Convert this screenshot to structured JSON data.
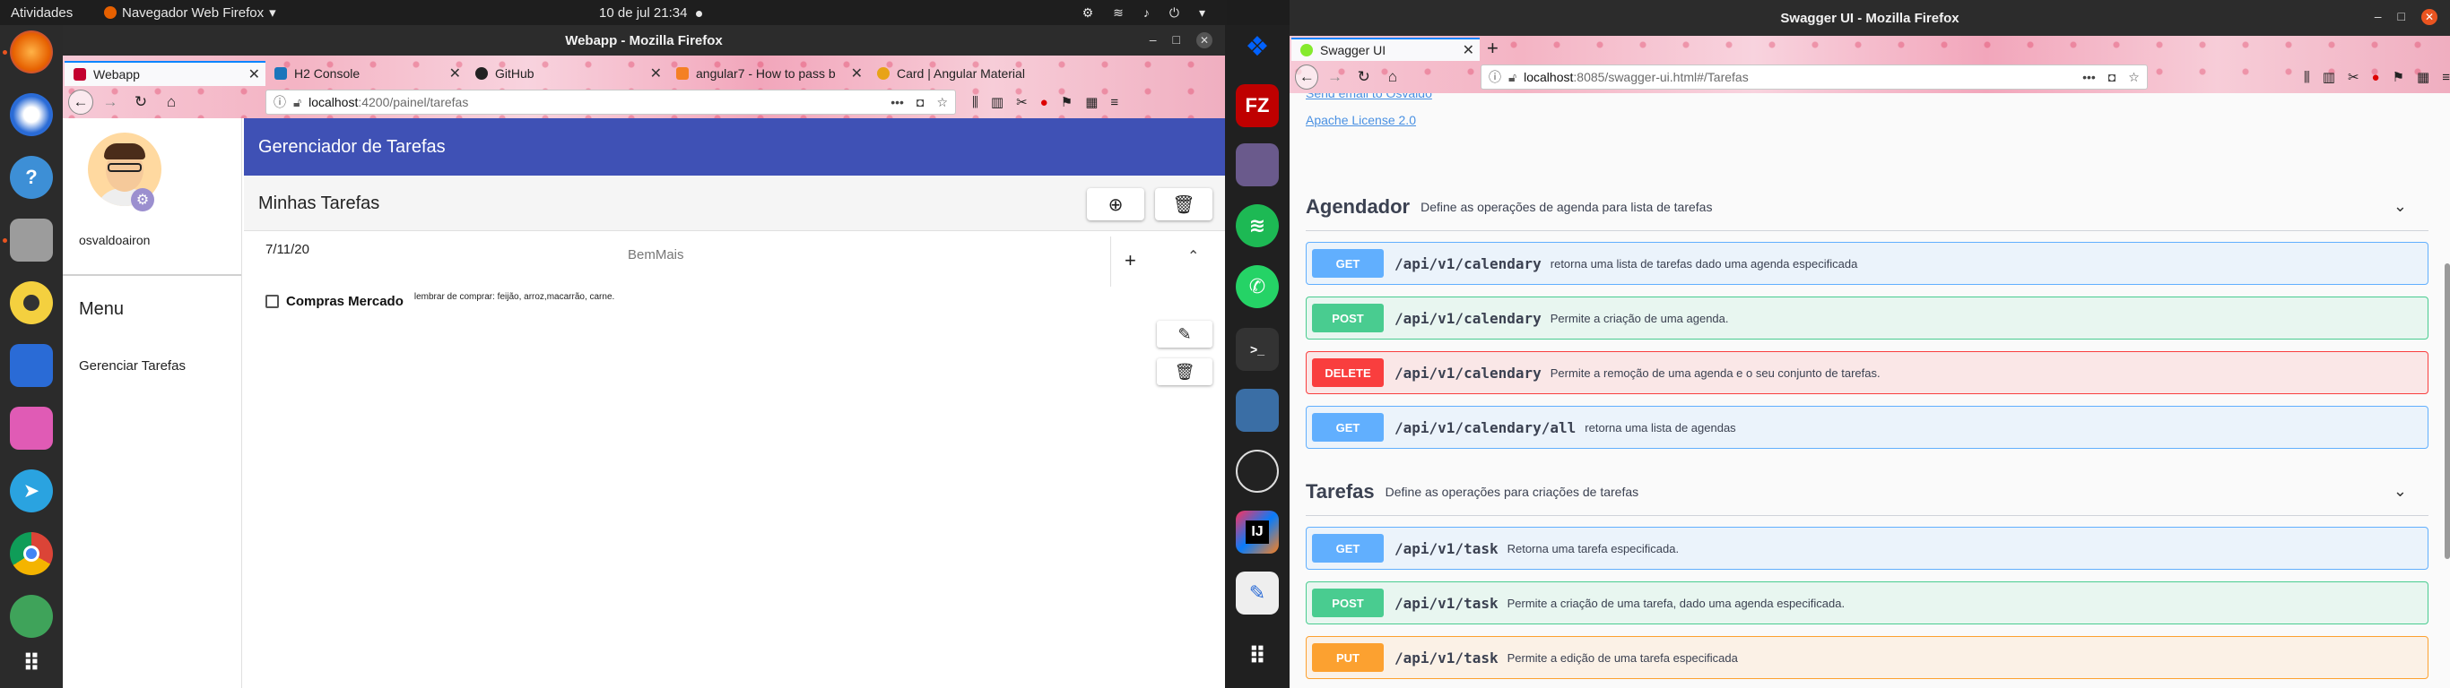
{
  "topbar": {
    "activities": "Atividades",
    "app_name": "Navegador Web Firefox",
    "clock": "10 de jul  21:34"
  },
  "left_window": {
    "title": "Webapp - Mozilla Firefox",
    "tabs": [
      {
        "label": "Webapp",
        "color": "#c3002f"
      },
      {
        "label": "H2 Console",
        "color": "#1b75bb"
      },
      {
        "label": "GitHub",
        "color": "#222222"
      },
      {
        "label": "angular7 - How to pass b",
        "color": "#f48024"
      },
      {
        "label": "Card | Angular Material",
        "color": "#e8a317"
      }
    ],
    "url_host": "localhost",
    "url_path": ":4200/painel/tarefas",
    "app": {
      "username": "osvaldoairon",
      "menu_title": "Menu",
      "menu_item": "Gerenciar Tarefas",
      "header_title": "Gerenciador de Tarefas",
      "section_title": "Minhas Tarefas",
      "card_date": "7/11/20",
      "card_org": "BemMais",
      "task_title": "Compras Mercado",
      "task_note": "lembrar de comprar: feijão, arroz,macarrão, carne."
    }
  },
  "right_window": {
    "title": "Swagger UI - Mozilla Firefox",
    "tab_label": "Swagger UI",
    "url_host": "localhost",
    "url_path": ":8085/swagger-ui.html#/Tarefas",
    "partial_link": "Send email to Osvaldo",
    "license_link": "Apache License 2.0",
    "sections": [
      {
        "name": "Agendador",
        "desc": "Define as operações de agenda para lista de tarefas",
        "ops": [
          {
            "method": "GET",
            "path": "/api/v1/calendary",
            "desc": "retorna uma lista de tarefas dado uma agenda especificada"
          },
          {
            "method": "POST",
            "path": "/api/v1/calendary",
            "desc": "Permite a criação de uma agenda."
          },
          {
            "method": "DELETE",
            "path": "/api/v1/calendary",
            "desc": "Permite a remoção de uma agenda e o seu conjunto de tarefas."
          },
          {
            "method": "GET",
            "path": "/api/v1/calendary/all",
            "desc": "retorna uma lista de agendas"
          }
        ]
      },
      {
        "name": "Tarefas",
        "desc": "Define as operações para criações de tarefas",
        "ops": [
          {
            "method": "GET",
            "path": "/api/v1/task",
            "desc": "Retorna uma tarefa especificada."
          },
          {
            "method": "POST",
            "path": "/api/v1/task",
            "desc": "Permite a criação de uma tarefa, dado uma agenda especificada."
          },
          {
            "method": "PUT",
            "path": "/api/v1/task",
            "desc": "Permite a edição de uma tarefa especificada"
          }
        ]
      }
    ]
  }
}
